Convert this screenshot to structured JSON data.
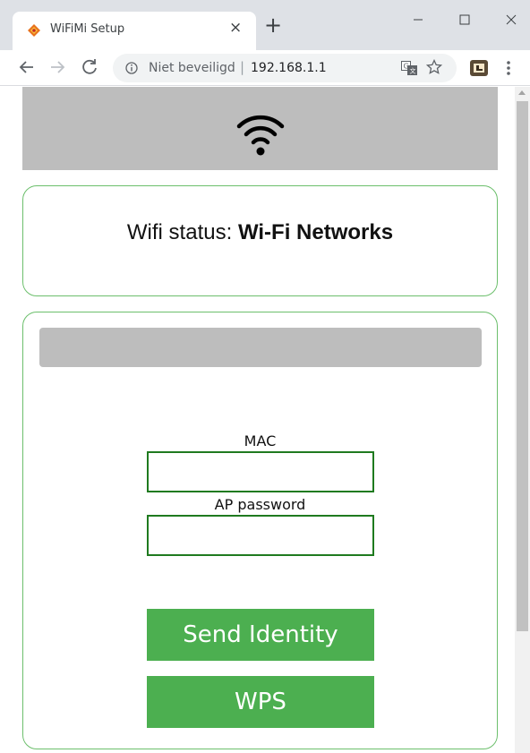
{
  "browser": {
    "tab": {
      "title": "WiFiMi Setup",
      "close": "×"
    },
    "new_tab": "+",
    "omnibox": {
      "security_label": "Niet beveiligd",
      "separator": "|",
      "url": "192.168.1.1"
    },
    "icons": {
      "favicon": "favicon-icon",
      "back": "arrow-left-icon",
      "forward": "arrow-right-icon",
      "reload": "reload-icon",
      "info": "info-icon",
      "translate": "translate-icon",
      "bookmark": "star-icon",
      "extension": "extension-icon",
      "menu": "menu-dots-icon"
    }
  },
  "page": {
    "header": {
      "icon": "wifi-icon",
      "background": "#bdbdbd"
    },
    "status": {
      "label": "Wifi status:",
      "value": "Wi-Fi Networks"
    },
    "form": {
      "mac_label": "MAC",
      "mac_value": "",
      "password_label": "AP password",
      "password_value": "",
      "send_identity": "Send Identity",
      "wps": "WPS"
    }
  },
  "colors": {
    "accent": "#4caf50",
    "input_border": "#1f7a1f",
    "card_border": "#6cbf6c",
    "band": "#bdbdbd",
    "chrome": "#dee1e6"
  }
}
